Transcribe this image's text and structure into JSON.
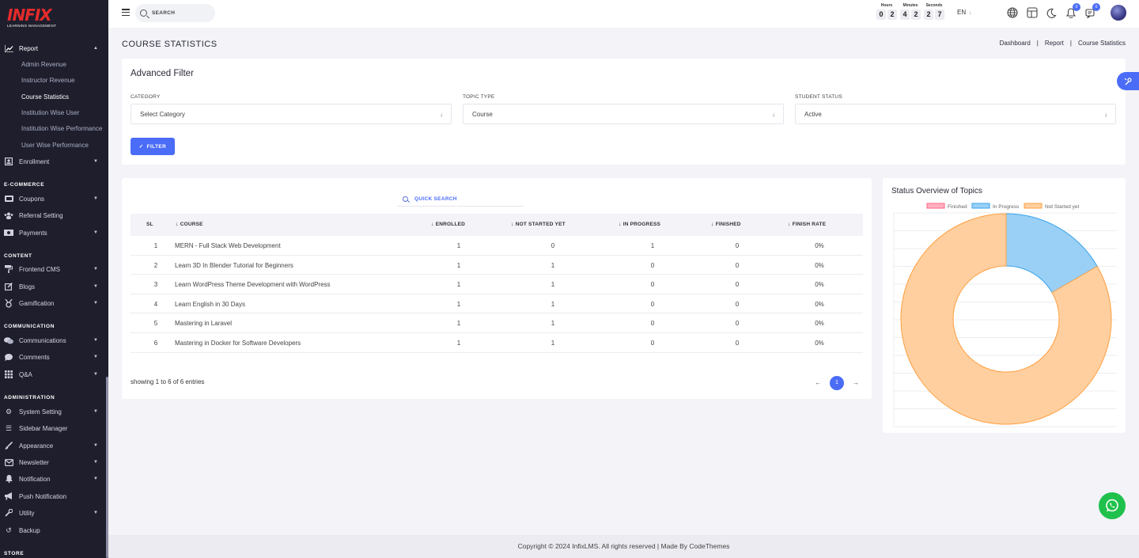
{
  "brand": {
    "name": "INFIX",
    "subtitle": "LEARNING MANAGEMENT"
  },
  "search": {
    "placeholder": "SEARCH"
  },
  "timer": {
    "hours_label": "Hours",
    "hours": [
      "0",
      "2"
    ],
    "minutes_label": "Minutes",
    "minutes": [
      "4",
      "2"
    ],
    "seconds_label": "Seconds",
    "seconds": [
      "2",
      "7"
    ]
  },
  "language": "EN",
  "notifications": {
    "bell_count": "0",
    "messages_count": "0"
  },
  "sidebar": {
    "report": "Report",
    "report_children": [
      "Admin Revenue",
      "Instructor Revenue",
      "Course Statistics",
      "Institution Wise User",
      "Institution Wise Performance",
      "User Wise Performance"
    ],
    "enrollment": "Enrollment",
    "sections": {
      "ecommerce": "E-COMMERCE",
      "content": "CONTENT",
      "communication": "COMMUNICATION",
      "administration": "ADMINISTRATION",
      "store": "STORE"
    },
    "ecommerce_items": [
      "Coupons",
      "Referral Setting",
      "Payments"
    ],
    "content_items": [
      "Frontend CMS",
      "Blogs",
      "Gamification"
    ],
    "communication_items": [
      "Communications",
      "Comments",
      "Q&A"
    ],
    "administration_items": [
      "System Setting",
      "Sidebar Manager",
      "Appearance",
      "Newsletter",
      "Notification",
      "Push Notification",
      "Utility",
      "Backup"
    ]
  },
  "page": {
    "title": "COURSE STATISTICS",
    "breadcrumb": [
      "Dashboard",
      "Report",
      "Course Statistics"
    ]
  },
  "filter": {
    "title": "Advanced Filter",
    "category_label": "CATEGORY",
    "category_value": "Select Category",
    "topic_label": "TOPIC TYPE",
    "topic_value": "Course",
    "status_label": "STUDENT STATUS",
    "status_value": "Active",
    "button": "FILTER"
  },
  "table": {
    "quick_search": "QUICK SEARCH",
    "headers": {
      "sl": "SL",
      "course": "COURSE",
      "enrolled": "ENROLLED",
      "not_started": "NOT STARTED YET",
      "in_progress": "IN PROGRESS",
      "finished": "FINISHED",
      "finish_rate": "FINISH RATE"
    },
    "rows": [
      {
        "sl": "1",
        "course": "MERN - Full Stack Web Development",
        "enrolled": "1",
        "not_started": "0",
        "in_progress": "1",
        "finished": "0",
        "rate": "0%"
      },
      {
        "sl": "2",
        "course": "Learn 3D In Blender Tutorial for Beginners",
        "enrolled": "1",
        "not_started": "1",
        "in_progress": "0",
        "finished": "0",
        "rate": "0%"
      },
      {
        "sl": "3",
        "course": "Learn WordPress Theme Development with WordPress",
        "enrolled": "1",
        "not_started": "1",
        "in_progress": "0",
        "finished": "0",
        "rate": "0%"
      },
      {
        "sl": "4",
        "course": "Learn English in 30 Days",
        "enrolled": "1",
        "not_started": "1",
        "in_progress": "0",
        "finished": "0",
        "rate": "0%"
      },
      {
        "sl": "5",
        "course": "Mastering in Laravel",
        "enrolled": "1",
        "not_started": "1",
        "in_progress": "0",
        "finished": "0",
        "rate": "0%"
      },
      {
        "sl": "6",
        "course": "Mastering in Docker for Software Developers",
        "enrolled": "1",
        "not_started": "1",
        "in_progress": "0",
        "finished": "0",
        "rate": "0%"
      }
    ],
    "entries_text": "showing 1 to 6 of 6 entries",
    "page_number": "1"
  },
  "chart_data": {
    "type": "pie",
    "title": "Status Overview of Topics",
    "categories": [
      "Finished",
      "In Progress",
      "Not Started yet"
    ],
    "values": [
      0,
      1,
      5
    ],
    "colors": [
      "#ffb1c1",
      "#9ad0f5",
      "#ffcf9f"
    ],
    "borders": [
      "#ff6384",
      "#36a2eb",
      "#ff9f40"
    ],
    "legend": "top",
    "donut": true
  },
  "footer": "Copyright © 2024 InfixLMS. All rights reserved | Made By CodeThemes"
}
